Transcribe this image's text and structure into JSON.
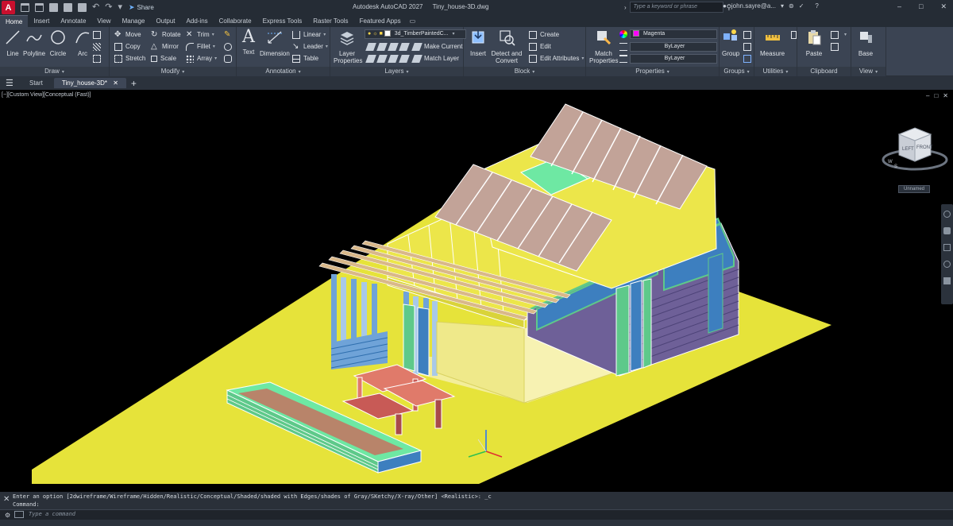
{
  "titlebar": {
    "app_letter": "A",
    "share_label": "Share",
    "app_name": "Autodesk AutoCAD 2027",
    "file_name": "Tiny_house-3D.dwg",
    "search_placeholder": "Type a keyword or phrase",
    "user": "john.sayre@a..."
  },
  "ribbon_tabs": [
    "Home",
    "Insert",
    "Annotate",
    "View",
    "Manage",
    "Output",
    "Add-ins",
    "Collaborate",
    "Express Tools",
    "Raster Tools",
    "Featured Apps"
  ],
  "draw": {
    "title": "Draw",
    "line": "Line",
    "polyline": "Polyline",
    "circle": "Circle",
    "arc": "Arc"
  },
  "modify": {
    "title": "Modify",
    "move": "Move",
    "copy": "Copy",
    "stretch": "Stretch",
    "rotate": "Rotate",
    "mirror": "Mirror",
    "scale": "Scale",
    "trim": "Trim",
    "fillet": "Fillet",
    "array": "Array"
  },
  "annotation": {
    "title": "Annotation",
    "text": "Text",
    "dimension": "Dimension",
    "linear": "Linear",
    "leader": "Leader",
    "table": "Table"
  },
  "layers": {
    "title": "Layers",
    "layer_properties": "Layer Properties",
    "current_layer": "3d_TimberPaintedC...",
    "make_current": "Make Current",
    "match_layer": "Match Layer"
  },
  "block": {
    "title": "Block",
    "insert": "Insert",
    "detect_convert": "Detect and Convert",
    "create": "Create",
    "edit": "Edit",
    "edit_attributes": "Edit Attributes"
  },
  "properties": {
    "title": "Properties",
    "match_properties": "Match Properties",
    "color": "Magenta",
    "linetype": "ByLayer",
    "lineweight": "ByLayer"
  },
  "groups": {
    "title": "Groups",
    "group": "Group"
  },
  "utilities": {
    "title": "Utilities",
    "measure": "Measure"
  },
  "clipboard": {
    "title": "Clipboard",
    "paste": "Paste"
  },
  "view": {
    "title": "View",
    "base": "Base"
  },
  "file_tabs": {
    "start": "Start",
    "active": "Tiny_house-3D*"
  },
  "viewport": {
    "label": "[−][Custom View][Conceptual (Fast)]",
    "viewcube_left": "LEFT",
    "viewcube_front": "FRONT",
    "compass_w": "W",
    "compass_s": "S",
    "view_name": "Unnamed"
  },
  "command": {
    "history": "Enter an option [2dwireframe/Wireframe/Hidden/Realistic/Conceptual/Shaded/shaded with Edges/shades of Gray/SKetchy/X-ray/Other] <Realistic>: _c",
    "prompt": "Command:",
    "placeholder": "Type a command"
  },
  "colors": {
    "ground": "#e6e33a",
    "roof_panel": "#c2a398",
    "skylight": "#6ee8a3",
    "gable": "#3d7fbf",
    "siding": "#6e6098",
    "accent_green": "#5ec98a",
    "interior_glow": "#efe98a"
  }
}
